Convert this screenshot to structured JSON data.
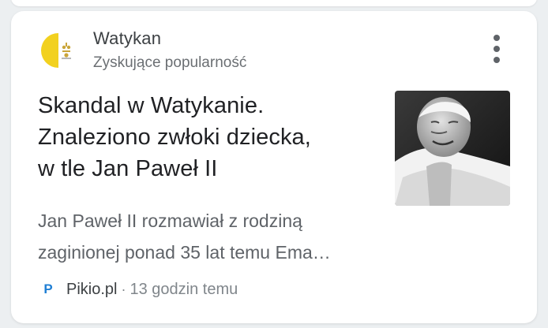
{
  "topic": {
    "name": "Watykan",
    "status": "Zyskujące popularność",
    "icon": "vatican-flag-icon",
    "colors": {
      "yellow": "#f2d11f",
      "white": "#ffffff"
    }
  },
  "article": {
    "headline_lines": [
      "Skandal w Watykanie.",
      "Znaleziono zwłoki dziecka,",
      "w tle Jan Paweł II"
    ],
    "snippet_lines": [
      "Jan Paweł II rozmawiał z rodziną",
      "zaginionej ponad 35 lat temu Ema…"
    ],
    "thumbnail": "pope-photo"
  },
  "source": {
    "favicon": "P",
    "name": "Pikio.pl",
    "separator": "·",
    "time": "13 godzin temu"
  },
  "menu": {
    "icon": "more-vert-icon"
  }
}
